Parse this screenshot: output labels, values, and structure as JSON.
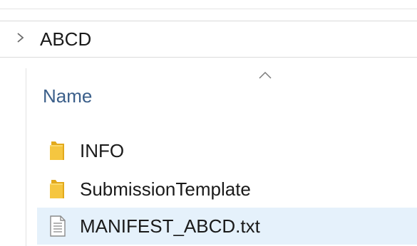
{
  "address_bar": {
    "breadcrumb": "ABCD"
  },
  "file_list": {
    "column_header": "Name",
    "items": [
      {
        "name": "INFO",
        "icon": "folder-icon"
      },
      {
        "name": "SubmissionTemplate",
        "icon": "folder-icon"
      },
      {
        "name": "MANIFEST_ABCD.txt",
        "icon": "text-file-icon"
      }
    ]
  },
  "colors": {
    "folder": "#f5c640",
    "folder_dark": "#e2a91c",
    "selected_row": "#e5f1fb",
    "header_text": "#3b5f8a"
  }
}
